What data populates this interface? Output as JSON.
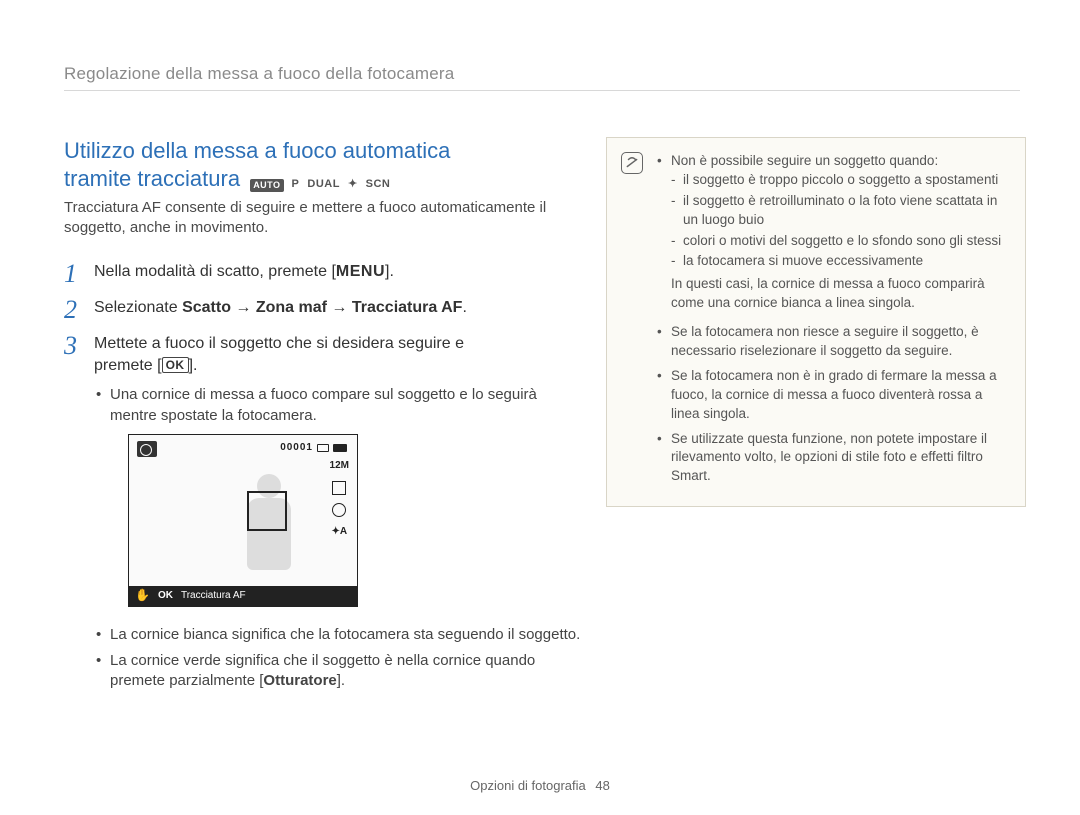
{
  "breadcrumb": "Regolazione della messa a fuoco della fotocamera",
  "title_line1": "Utilizzo della messa a fuoco automatica",
  "title_line2": "tramite tracciatura",
  "mode_icons": {
    "auto": "AUTO",
    "p": "P",
    "dual": "DUAL",
    "flash": "✦",
    "scn": "SCN"
  },
  "intro": "Tracciatura AF consente di seguire e mettere a fuoco automaticamente il soggetto, anche in movimento.",
  "steps": {
    "s1_pre": "Nella modalità di scatto, premete [",
    "s1_btn": "MENU",
    "s1_post": "].",
    "s2_pre": "Selezionate ",
    "s2_b1": "Scatto",
    "s2_arrow": " → ",
    "s2_b2": "Zona maf",
    "s2_b3": "Tracciatura AF",
    "s2_post": ".",
    "s3_line1": "Mettete a fuoco il soggetto che si desidera seguire e",
    "s3_line2_pre": "premete [",
    "s3_btn": "OK",
    "s3_line2_post": "].",
    "s3_sub1": "Una cornice di messa a fuoco compare sul soggetto e lo seguirà mentre spostate la fotocamera."
  },
  "screenshot": {
    "counter": "00001",
    "size": "12M",
    "flash": "✦A",
    "status_ok": "OK",
    "status_label": "Tracciatura AF"
  },
  "post_bullets": {
    "b1": "La cornice bianca significa che la fotocamera sta seguendo il soggetto.",
    "b2_pre": "La cornice verde significa che il soggetto è nella cornice quando premete parzialmente [",
    "b2_bold": "Otturatore",
    "b2_post": "]."
  },
  "note": {
    "n1": "Non è possibile seguire un soggetto quando:",
    "n1a": "il soggetto è troppo piccolo o soggetto a spostamenti",
    "n1b": "il soggetto è retroilluminato o la foto viene scattata in un luogo buio",
    "n1c": "colori o motivi del soggetto e lo sfondo sono gli stessi",
    "n1d": "la fotocamera si muove eccessivamente",
    "n1_cont": "In questi casi, la cornice di messa a fuoco comparirà come una cornice bianca a linea singola.",
    "n2": "Se la fotocamera non riesce a seguire il soggetto, è necessario riselezionare il soggetto da seguire.",
    "n3": "Se la fotocamera non è in grado di fermare la messa a fuoco, la cornice di messa a fuoco diventerà rossa a linea singola.",
    "n4": "Se utilizzate questa funzione, non potete impostare il rilevamento volto, le opzioni di stile foto e effetti filtro Smart."
  },
  "footer": {
    "section": "Opzioni di fotografia",
    "page": "48"
  }
}
